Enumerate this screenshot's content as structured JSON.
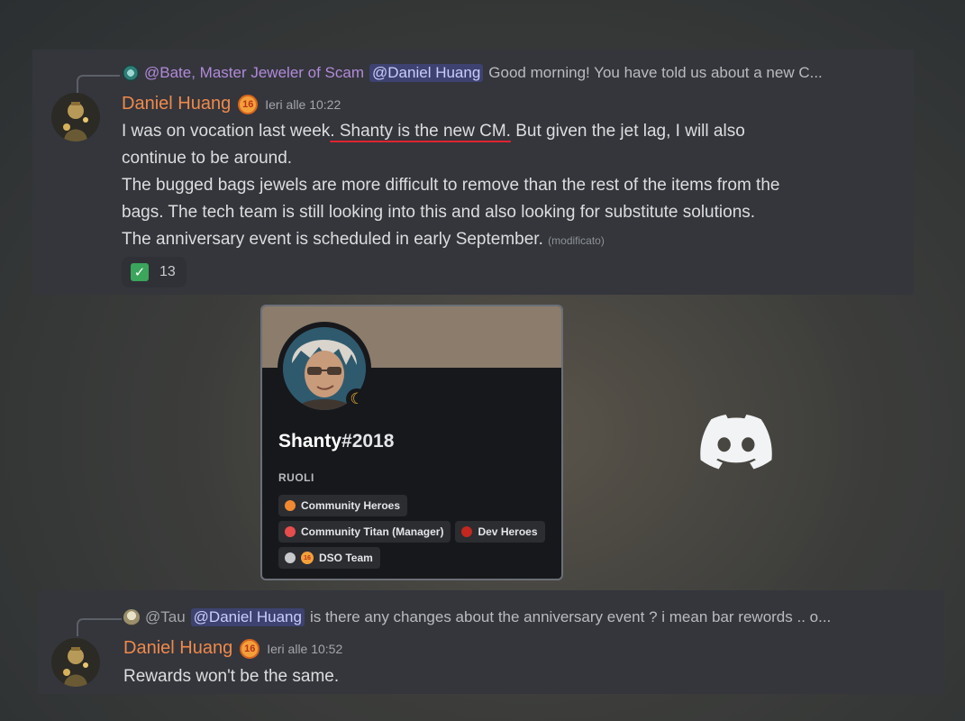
{
  "message_top": {
    "reply": {
      "author": "@Bate, Master Jeweler of Scam",
      "mention": "@Daniel Huang",
      "text": "Good morning! You have told us about a new C..."
    },
    "author": "Daniel Huang",
    "badge": "16",
    "timestamp": "Ieri alle 10:22",
    "lines": {
      "l1_before": "I was on vocation last week",
      "l1_underlined": ". Shanty is the new CM.",
      "l1_after": " But given the jet lag, I will also",
      "l2": "continue to be around.",
      "l3": "The bugged bags jewels are more difficult to remove than the rest of the items from the",
      "l4": "bags. The tech team is still looking into this and also looking for substitute solutions.",
      "l5": "The anniversary event is scheduled in early September."
    },
    "edited": "(modificato)",
    "reaction": {
      "emoji": "✓",
      "count": "13"
    }
  },
  "profile": {
    "username": "Shanty",
    "discriminator": "#2018",
    "roles_heading": "RUOLI",
    "roles": [
      {
        "label": "Community Heroes",
        "color": "#f0892f"
      },
      {
        "label": "Community Titan (Manager)",
        "color": "#e84c4c"
      },
      {
        "label": "Dev Heroes",
        "color": "#c3271d"
      },
      {
        "label": "DSO Team",
        "color": "#c8c9cc",
        "badge": "16"
      }
    ],
    "status_icon": "☾"
  },
  "message_bottom": {
    "reply": {
      "author": "@Tau",
      "mention": "@Daniel Huang",
      "text": "is there any changes about the anniversary event ? i mean bar rewords .. o..."
    },
    "author": "Daniel Huang",
    "badge": "16",
    "timestamp": "Ieri alle 10:52",
    "text": "Rewards won't be the same."
  },
  "colors": {
    "accent_username": "#f0894a",
    "mention_bg": "#3d4270",
    "underline": "#e0242f"
  },
  "icons": {
    "logo": "discord-logo-icon",
    "reaction": "white-check-mark-icon",
    "status": "idle-moon-icon"
  }
}
